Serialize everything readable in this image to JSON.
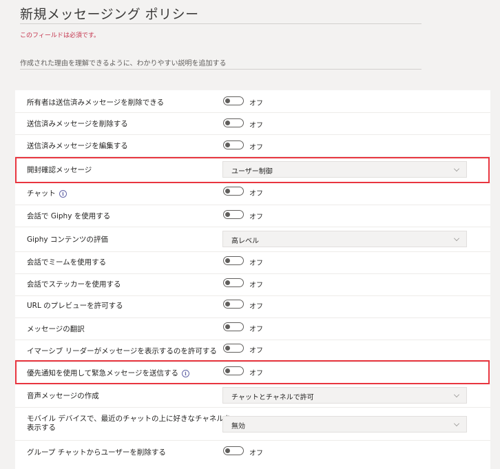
{
  "page_title": "新規メッセージング ポリシー",
  "required_message": "このフィールドは必須です。",
  "description_placeholder": "作成された理由を理解できるように、わかりやすい説明を追加する",
  "colors": {
    "highlight": "#e8353f",
    "required": "#c4314b"
  },
  "settings": [
    {
      "label": "所有者は送信済みメッセージを削除できる",
      "type": "toggle",
      "value": "オフ"
    },
    {
      "label": "送信済みメッセージを削除する",
      "type": "toggle",
      "value": "オフ"
    },
    {
      "label": "送信済みメッセージを編集する",
      "type": "toggle",
      "value": "オフ"
    },
    {
      "label": "開封確認メッセージ",
      "type": "select",
      "value": "ユーザー制御"
    },
    {
      "label": "チャット",
      "type": "toggle",
      "value": "オフ",
      "info": "i"
    },
    {
      "label": "会話で Giphy を使用する",
      "type": "toggle",
      "value": "オフ"
    },
    {
      "label": "Giphy コンテンツの評価",
      "type": "select",
      "value": "高レベル"
    },
    {
      "label": "会話でミームを使用する",
      "type": "toggle",
      "value": "オフ"
    },
    {
      "label": "会話でステッカーを使用する",
      "type": "toggle",
      "value": "オフ"
    },
    {
      "label": "URL のプレビューを許可する",
      "type": "toggle",
      "value": "オフ"
    },
    {
      "label": "メッセージの翻訳",
      "type": "toggle",
      "value": "オフ"
    },
    {
      "label": "イマーシブ リーダーがメッセージを表示するのを許可する",
      "type": "toggle",
      "value": "オフ"
    },
    {
      "label": "優先通知を使用して緊急メッセージを送信する",
      "type": "toggle",
      "value": "オフ",
      "info": "i"
    },
    {
      "label": "音声メッセージの作成",
      "type": "select",
      "value": "チャットとチャネルで許可"
    },
    {
      "label_line1": "モバイル デバイスで、最近のチャットの上に好きなチャネルを",
      "label_line2": "表示する",
      "type": "select",
      "value": "無効"
    },
    {
      "label": "グループ チャットからユーザーを削除する",
      "type": "toggle",
      "value": "オフ"
    }
  ]
}
